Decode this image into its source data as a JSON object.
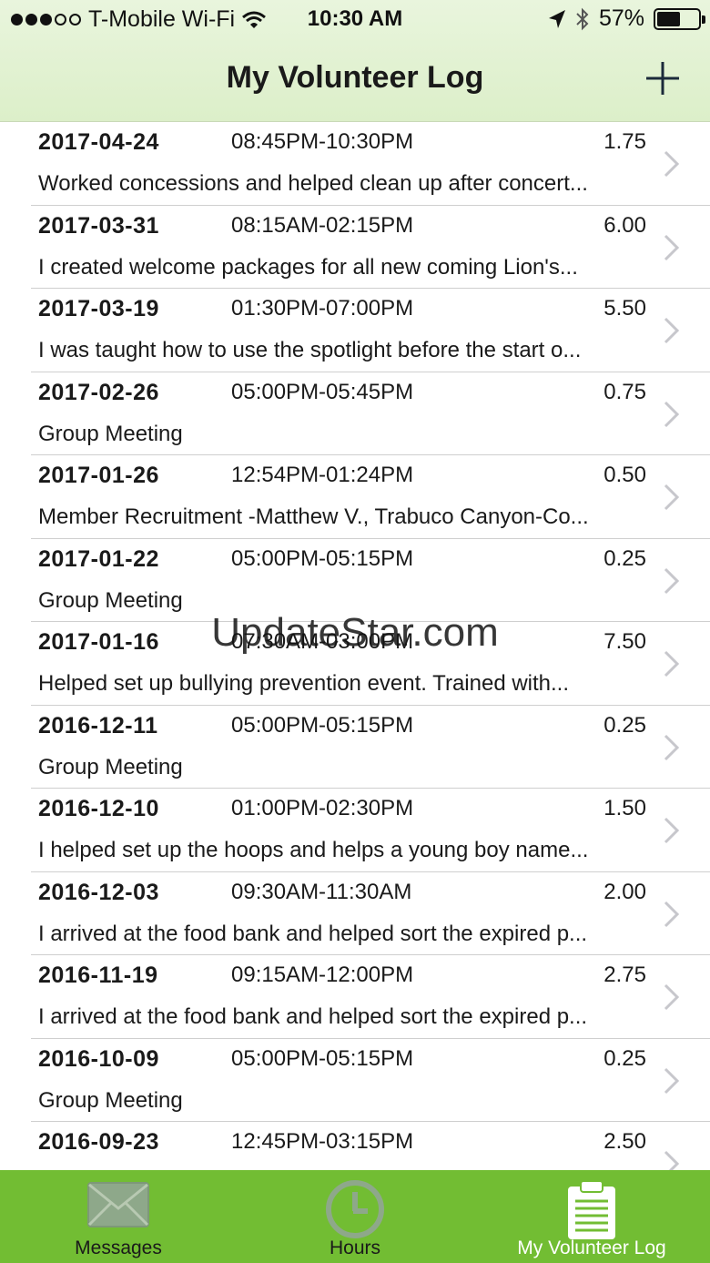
{
  "status_bar": {
    "carrier": "T-Mobile Wi-Fi",
    "time": "10:30 AM",
    "battery_percent": "57%",
    "battery_level": 0.57,
    "signal_bars_filled": 3,
    "signal_bars_total": 5,
    "icons": [
      "wifi-icon",
      "location-arrow-icon",
      "bluetooth-icon",
      "battery-icon"
    ]
  },
  "nav": {
    "title": "My Volunteer Log",
    "add_icon": "plus-icon"
  },
  "entries": [
    {
      "date": "2017-04-24",
      "time": "08:45PM-10:30PM",
      "hours": "1.75",
      "description": "Worked concessions and helped clean up after concert..."
    },
    {
      "date": "2017-03-31",
      "time": "08:15AM-02:15PM",
      "hours": "6.00",
      "description": "I created welcome packages for all new coming Lion's..."
    },
    {
      "date": "2017-03-19",
      "time": "01:30PM-07:00PM",
      "hours": "5.50",
      "description": "I was taught how to use the spotlight before the start o..."
    },
    {
      "date": "2017-02-26",
      "time": "05:00PM-05:45PM",
      "hours": "0.75",
      "description": "Group Meeting"
    },
    {
      "date": "2017-01-26",
      "time": "12:54PM-01:24PM",
      "hours": "0.50",
      "description": "Member Recruitment -Matthew V., Trabuco Canyon-Co..."
    },
    {
      "date": "2017-01-22",
      "time": "05:00PM-05:15PM",
      "hours": "0.25",
      "description": "Group Meeting"
    },
    {
      "date": "2017-01-16",
      "time": "07:30AM-03:00PM",
      "hours": "7.50",
      "description": "Helped set up bullying prevention event.  Trained with..."
    },
    {
      "date": "2016-12-11",
      "time": "05:00PM-05:15PM",
      "hours": "0.25",
      "description": "Group Meeting"
    },
    {
      "date": "2016-12-10",
      "time": "01:00PM-02:30PM",
      "hours": "1.50",
      "description": "I helped set up the hoops and helps a young boy name..."
    },
    {
      "date": "2016-12-03",
      "time": "09:30AM-11:30AM",
      "hours": "2.00",
      "description": "I arrived at the food bank and helped sort the expired p..."
    },
    {
      "date": "2016-11-19",
      "time": "09:15AM-12:00PM",
      "hours": "2.75",
      "description": "I arrived at the food bank and helped sort the expired p..."
    },
    {
      "date": "2016-10-09",
      "time": "05:00PM-05:15PM",
      "hours": "0.25",
      "description": "Group Meeting"
    },
    {
      "date": "2016-09-23",
      "time": "12:45PM-03:15PM",
      "hours": "2.50",
      "description": ""
    }
  ],
  "tabs": [
    {
      "label": "Messages",
      "icon": "envelope-icon",
      "active": false
    },
    {
      "label": "Hours",
      "icon": "clock-icon",
      "active": false
    },
    {
      "label": "My Volunteer Log",
      "icon": "clipboard-icon",
      "active": true
    }
  ],
  "watermark": "UpdateStar.com",
  "colors": {
    "nav_background": "#e2f2d2",
    "tab_bar": "#72bd33",
    "active_tab_label": "#ffffff",
    "inactive_tab_label": "#8db57a",
    "chevron": "#c7c7cc"
  }
}
